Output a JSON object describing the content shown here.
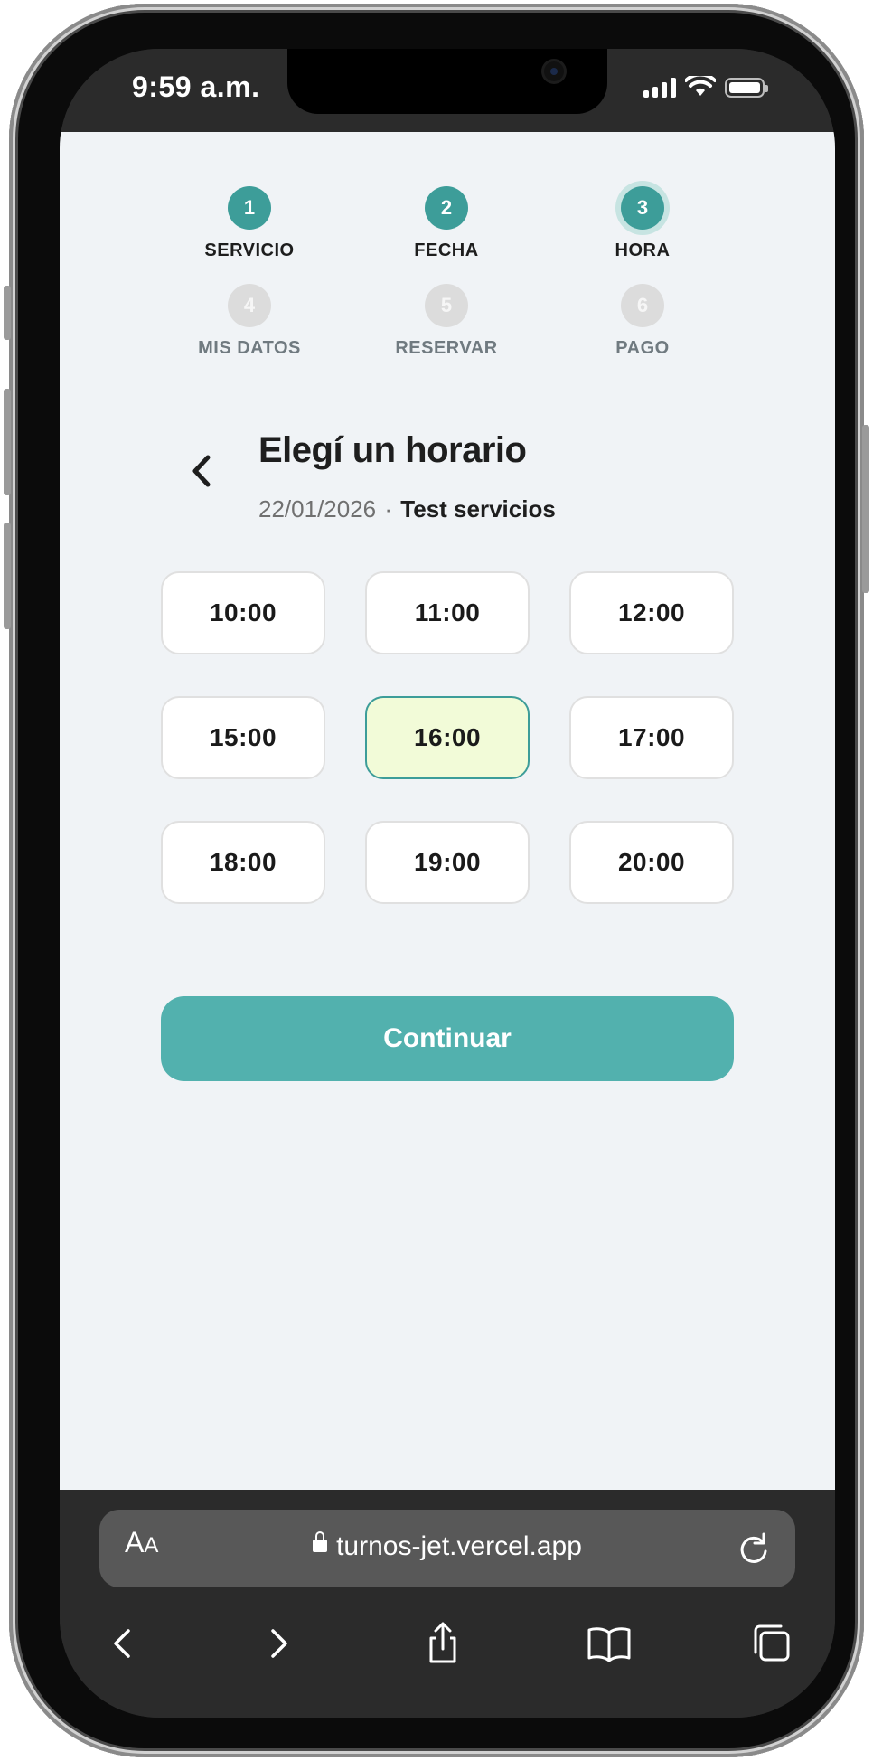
{
  "status_bar": {
    "time": "9:59 a.m."
  },
  "steps": [
    {
      "number": "1",
      "label": "SERVICIO",
      "state": "done"
    },
    {
      "number": "2",
      "label": "FECHA",
      "state": "done"
    },
    {
      "number": "3",
      "label": "HORA",
      "state": "current"
    },
    {
      "number": "4",
      "label": "MIS DATOS",
      "state": "todo"
    },
    {
      "number": "5",
      "label": "RESERVAR",
      "state": "todo"
    },
    {
      "number": "6",
      "label": "PAGO",
      "state": "todo"
    }
  ],
  "header": {
    "title": "Elegí un horario",
    "date": "22/01/2026",
    "separator": "·",
    "service": "Test servicios"
  },
  "time_slots": [
    "10:00",
    "11:00",
    "12:00",
    "15:00",
    "16:00",
    "17:00",
    "18:00",
    "19:00",
    "20:00"
  ],
  "selected_slot": "16:00",
  "continue_label": "Continuar",
  "browser": {
    "text_size_label": "AA",
    "url": "turnos-jet.vercel.app"
  },
  "colors": {
    "accent": "#3d9d99",
    "button": "#52b1ae",
    "selected_slot_bg": "#f2fbd8"
  }
}
